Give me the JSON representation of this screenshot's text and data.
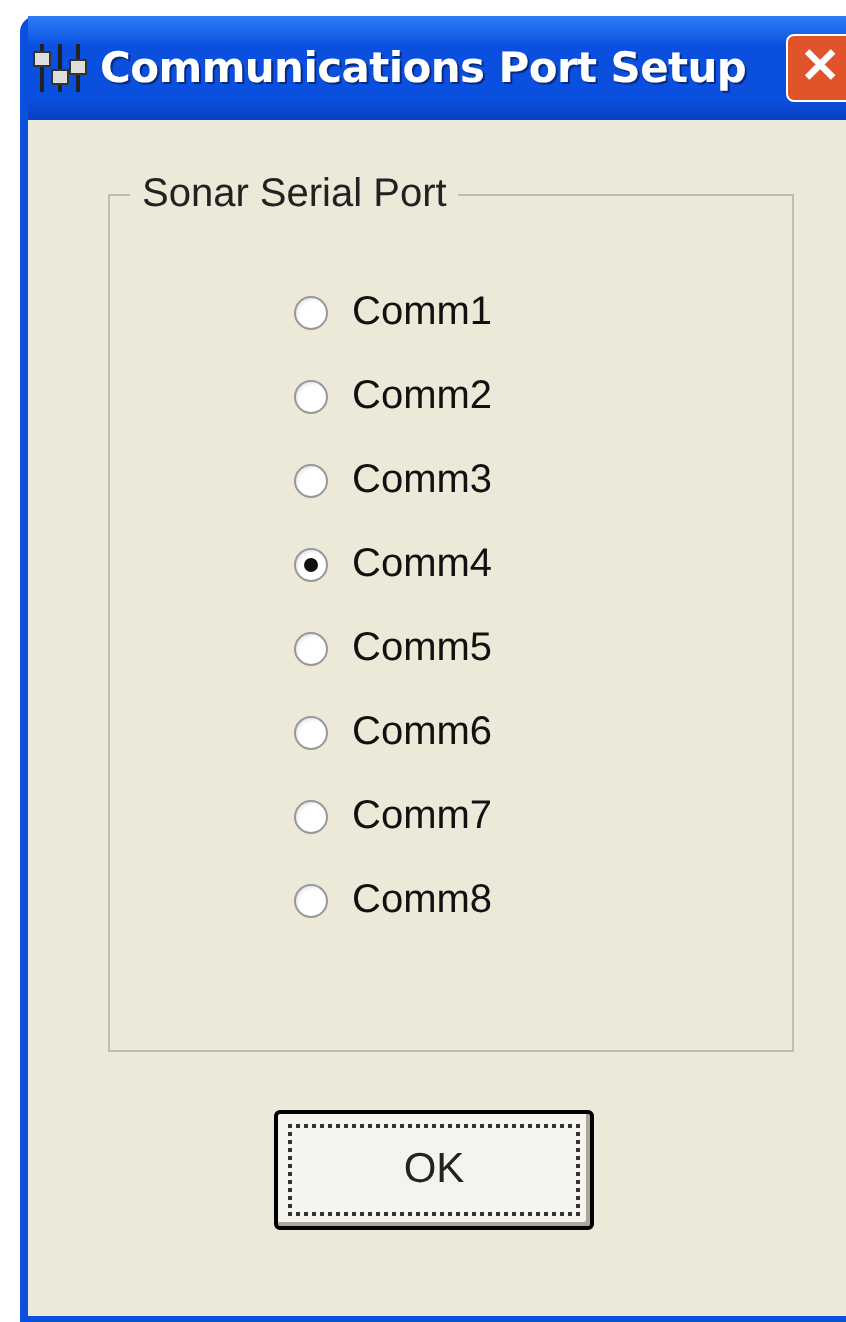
{
  "window": {
    "title": "Communications Port Setup",
    "close": "✕"
  },
  "group": {
    "title": "Sonar Serial Port",
    "options": [
      {
        "label": "Comm1",
        "selected": false
      },
      {
        "label": "Comm2",
        "selected": false
      },
      {
        "label": "Comm3",
        "selected": false
      },
      {
        "label": "Comm4",
        "selected": true
      },
      {
        "label": "Comm5",
        "selected": false
      },
      {
        "label": "Comm6",
        "selected": false
      },
      {
        "label": "Comm7",
        "selected": false
      },
      {
        "label": "Comm8",
        "selected": false
      }
    ]
  },
  "buttons": [
    {
      "label": "OK",
      "focused": true
    }
  ]
}
